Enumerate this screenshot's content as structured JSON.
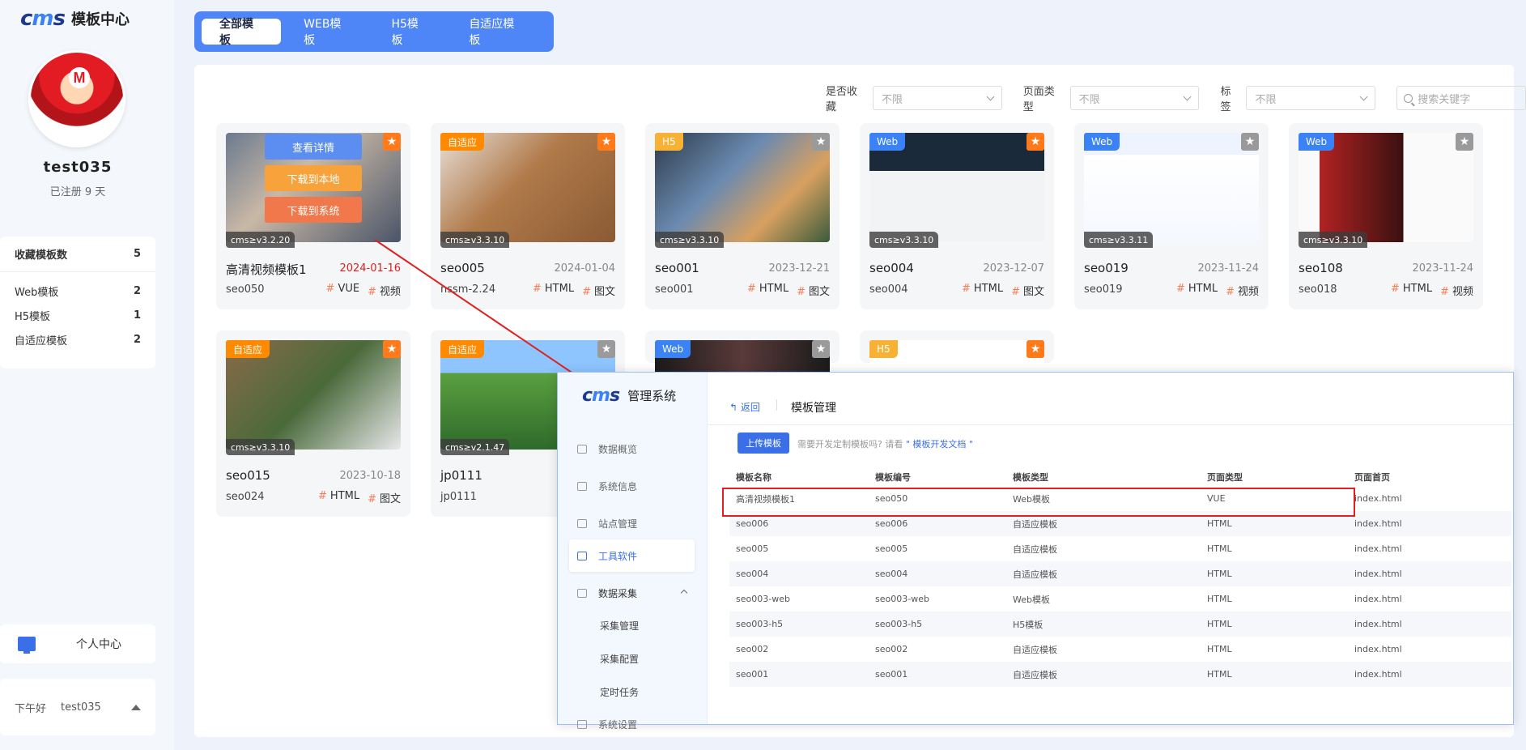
{
  "brand": {
    "logo": "cms",
    "title": "模板中心"
  },
  "user": {
    "name": "test035",
    "registered": "已注册 9 天"
  },
  "favorites": {
    "header": "收藏模板数",
    "total": "5",
    "items": [
      {
        "label": "Web模板",
        "count": "2"
      },
      {
        "label": "H5模板",
        "count": "1"
      },
      {
        "label": "自适应模板",
        "count": "2"
      }
    ]
  },
  "personal_center": "个人中心",
  "greeting": {
    "text": "下午好",
    "name": "test035"
  },
  "tabs": [
    "全部模板",
    "WEB模板",
    "H5模板",
    "自适应模板"
  ],
  "filters": {
    "fav_label": "是否收藏",
    "fav_value": "不限",
    "type_label": "页面类型",
    "type_value": "不限",
    "tag_label": "标签",
    "tag_value": "不限",
    "search_placeholder": "搜索关键字"
  },
  "hover_actions": {
    "detail": "查看详情",
    "download_local": "下载到本地",
    "download_system": "下载到系统"
  },
  "cards": [
    {
      "badge": "",
      "ver": "cms≥v3.2.20",
      "title": "高清视频模板1",
      "date": "2024-01-16",
      "code": "seo050",
      "tag1": "VUE",
      "tag2": "视频",
      "star_color": "#ff7a1a",
      "badge_color": ""
    },
    {
      "badge": "自适应",
      "ver": "cms≥v3.3.10",
      "title": "seo005",
      "date": "2024-01-04",
      "code": "nssm-2.24",
      "tag1": "HTML",
      "tag2": "图文",
      "star_color": "#ff7a1a",
      "badge_color": "#ff8a00"
    },
    {
      "badge": "H5",
      "ver": "cms≥v3.3.10",
      "title": "seo001",
      "date": "2023-12-21",
      "code": "seo001",
      "tag1": "HTML",
      "tag2": "图文",
      "star_color": "#9a9a9a",
      "badge_color": "#f7b135"
    },
    {
      "badge": "Web",
      "ver": "cms≥v3.3.10",
      "title": "seo004",
      "date": "2023-12-07",
      "code": "seo004",
      "tag1": "HTML",
      "tag2": "图文",
      "star_color": "#ff7a1a",
      "badge_color": "#3b82f6"
    },
    {
      "badge": "Web",
      "ver": "cms≥v3.3.11",
      "title": "seo019",
      "date": "2023-11-24",
      "code": "seo019",
      "tag1": "HTML",
      "tag2": "视频",
      "star_color": "#9a9a9a",
      "badge_color": "#3b82f6"
    },
    {
      "badge": "Web",
      "ver": "cms≥v3.3.10",
      "title": "seo108",
      "date": "2023-11-24",
      "code": "seo018",
      "tag1": "HTML",
      "tag2": "视频",
      "star_color": "#9a9a9a",
      "badge_color": "#3b82f6"
    },
    {
      "badge": "自适应",
      "ver": "cms≥v3.3.10",
      "title": "seo015",
      "date": "2023-10-18",
      "code": "seo024",
      "tag1": "HTML",
      "tag2": "图文",
      "star_color": "#ff7a1a",
      "badge_color": "#ff8a00"
    },
    {
      "badge": "自适应",
      "ver": "cms≥v2.1.47",
      "title": "jp0111",
      "date": "",
      "code": "jp0111",
      "tag1": "",
      "tag2": "",
      "star_color": "#9a9a9a",
      "badge_color": "#ff8a00"
    },
    {
      "badge": "Web",
      "ver": "",
      "title": "",
      "date": "",
      "code": "",
      "tag1": "",
      "tag2": "",
      "star_color": "#9a9a9a",
      "badge_color": "#3b82f6"
    },
    {
      "badge": "H5",
      "ver": "",
      "title": "",
      "date": "",
      "code": "",
      "tag1": "",
      "tag2": "",
      "star_color": "#ff7a1a",
      "badge_color": "#f7b135"
    }
  ],
  "admin": {
    "title": "管理系统",
    "nav": [
      "数据概览",
      "系统信息",
      "站点管理",
      "工具软件",
      "数据采集",
      "采集管理",
      "采集配置",
      "定时任务",
      "系统设置"
    ],
    "back": "返回",
    "page_title": "模板管理",
    "upload": "上传模板",
    "hint": "需要开发定制模板吗? 请看",
    "hint_link": "\" 模板开发文档 \"",
    "columns": [
      "模板名称",
      "模板编号",
      "模板类型",
      "页面类型",
      "页面首页"
    ],
    "rows": [
      [
        "高清视频模板1",
        "seo050",
        "Web模板",
        "VUE",
        "index.html"
      ],
      [
        "seo006",
        "seo006",
        "自适应模板",
        "HTML",
        "index.html"
      ],
      [
        "seo005",
        "seo005",
        "自适应模板",
        "HTML",
        "index.html"
      ],
      [
        "seo004",
        "seo004",
        "自适应模板",
        "HTML",
        "index.html"
      ],
      [
        "seo003-web",
        "seo003-web",
        "Web模板",
        "HTML",
        "index.html"
      ],
      [
        "seo003-h5",
        "seo003-h5",
        "H5模板",
        "HTML",
        "index.html"
      ],
      [
        "seo002",
        "seo002",
        "自适应模板",
        "HTML",
        "index.html"
      ],
      [
        "seo001",
        "seo001",
        "自适应模板",
        "HTML",
        "index.html"
      ]
    ]
  }
}
